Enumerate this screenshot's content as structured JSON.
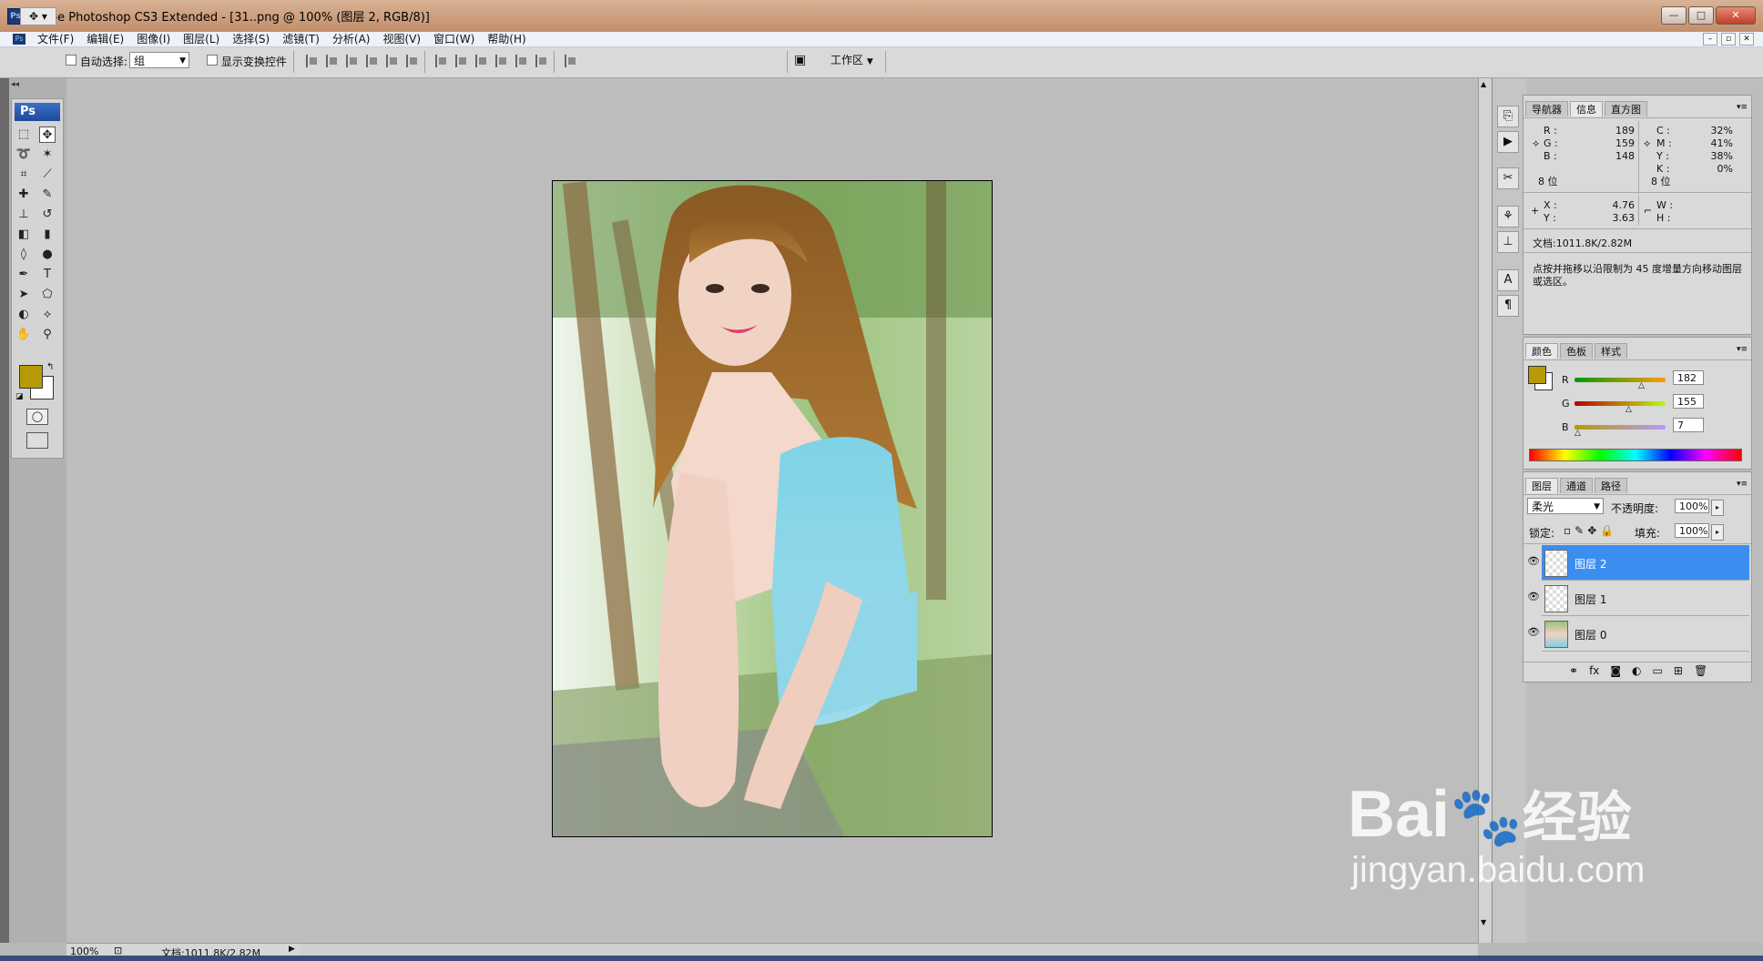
{
  "window": {
    "title": "Adobe Photoshop CS3 Extended - [31..png @ 100% (图层 2, RGB/8)]",
    "app_icon": "Ps",
    "buttons": [
      "—",
      "□",
      "✕"
    ]
  },
  "menu": {
    "items": [
      "文件(F)",
      "编辑(E)",
      "图像(I)",
      "图层(L)",
      "选择(S)",
      "滤镜(T)",
      "分析(A)",
      "视图(V)",
      "窗口(W)",
      "帮助(H)"
    ],
    "doc_controls": [
      "–",
      "▫",
      "✕"
    ]
  },
  "options": {
    "auto_select_label": "自动选择:",
    "auto_select_value": "组",
    "show_transform_label": "显示变换控件",
    "workspace_label": "工作区"
  },
  "toolbox": {
    "logo": "Ps",
    "foreground_color": "#b69b07",
    "background_color": "#ffffff"
  },
  "status": {
    "zoom": "100%",
    "doc_size": "文档:1011.8K/2.82M"
  },
  "info_panel": {
    "tabs": [
      "导航器",
      "信息",
      "直方图"
    ],
    "rgb": {
      "r_label": "R :",
      "r": "189",
      "g_label": "G :",
      "g": "159",
      "b_label": "B :",
      "b": "148"
    },
    "cmyk": {
      "c_label": "C :",
      "c": "32%",
      "m_label": "M :",
      "m": "41%",
      "y_label": "Y :",
      "y": "38%",
      "k_label": "K :",
      "k": "0%"
    },
    "bits_left": "8 位",
    "bits_right": "8 位",
    "x_label": "X :",
    "x": "4.76",
    "y_label": "Y :",
    "y_val": "3.63",
    "w_label": "W :",
    "h_label": "H :",
    "doc": "文档:1011.8K/2.82M",
    "hint": "点按并拖移以沿限制为 45 度增量方向移动图层或选区。"
  },
  "color_panel": {
    "tabs": [
      "颜色",
      "色板",
      "样式"
    ],
    "r_label": "R",
    "r": "182",
    "g_label": "G",
    "g": "155",
    "b_label": "B",
    "b": "7",
    "swatch": "#b69b07"
  },
  "layers_panel": {
    "tabs": [
      "图层",
      "通道",
      "路径"
    ],
    "blend_mode": "柔光",
    "opacity_label": "不透明度:",
    "opacity": "100%",
    "lock_label": "锁定:",
    "fill_label": "填充:",
    "fill": "100%",
    "layers": [
      {
        "name": "图层 2",
        "selected": true
      },
      {
        "name": "图层 1",
        "selected": false
      },
      {
        "name": "图层 0",
        "selected": false
      }
    ]
  },
  "watermark": {
    "brand": "Bai",
    "brand2": "经验",
    "url": "jingyan.baidu.com"
  }
}
